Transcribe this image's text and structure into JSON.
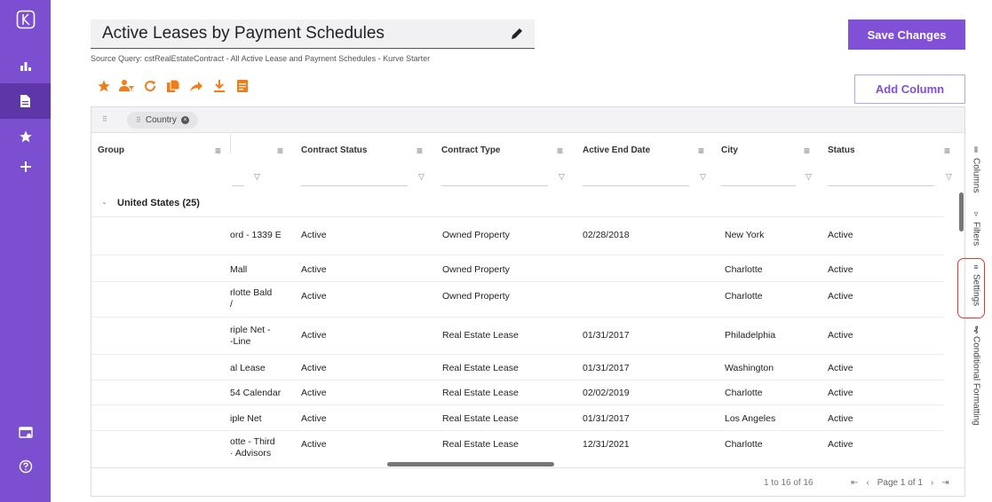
{
  "app": {
    "title": "Active Leases by Payment Schedules"
  },
  "nav": {
    "items": [
      {
        "id": "logo",
        "icon": "logo-icon"
      },
      {
        "id": "analytics",
        "icon": "bar-chart-icon"
      },
      {
        "id": "documents",
        "icon": "document-icon",
        "active": true
      },
      {
        "id": "favorites",
        "icon": "star-icon"
      },
      {
        "id": "add",
        "icon": "plus-icon"
      },
      {
        "id": "admin",
        "icon": "card-gear-icon"
      },
      {
        "id": "help",
        "icon": "help-icon"
      }
    ]
  },
  "header": {
    "source_query": "Source Query: cstRealEstateContract - All Active Lease and Payment Schedules - Kurve Starter",
    "save_label": "Save Changes",
    "add_column_label": "Add Column"
  },
  "toolbar": {
    "icons": [
      "star-icon",
      "person-filter-icon",
      "refresh-icon",
      "copy-icon",
      "share-icon",
      "download-icon",
      "notes-icon"
    ],
    "accent": "#f07d1a"
  },
  "grid": {
    "group_chip": "Country",
    "columns": {
      "group": "Group",
      "contract_status": "Contract Status",
      "contract_type": "Contract Type",
      "active_end_date": "Active End Date",
      "city": "City",
      "status": "Status"
    },
    "group_label": "United States (25)",
    "rows": [
      {
        "name": "ord - 1339 E",
        "contract_status": "Active",
        "contract_type": "Owned Property",
        "end_date": "02/28/2018",
        "city": "New York",
        "status": "Active"
      },
      {
        "name": "Mall",
        "contract_status": "Active",
        "contract_type": "Owned Property",
        "end_date": "",
        "city": "Charlotte",
        "status": "Active"
      },
      {
        "name": "rlotte Bald\n/",
        "contract_status": "Active",
        "contract_type": "Owned Property",
        "end_date": "",
        "city": "Charlotte",
        "status": "Active"
      },
      {
        "name": "riple Net -\n-Line",
        "contract_status": "Active",
        "contract_type": "Real Estate Lease",
        "end_date": "01/31/2017",
        "city": "Philadelphia",
        "status": "Active"
      },
      {
        "name": "al Lease",
        "contract_status": "Active",
        "contract_type": "Real Estate Lease",
        "end_date": "01/31/2017",
        "city": "Washington",
        "status": "Active"
      },
      {
        "name": "54 Calendar",
        "contract_status": "Active",
        "contract_type": "Real Estate Lease",
        "end_date": "02/02/2019",
        "city": "Charlotte",
        "status": "Active"
      },
      {
        "name": "iple Net",
        "contract_status": "Active",
        "contract_type": "Real Estate Lease",
        "end_date": "01/31/2017",
        "city": "Los Angeles",
        "status": "Active"
      },
      {
        "name": "otte - Third\n· Advisors",
        "contract_status": "Active",
        "contract_type": "Real Estate Lease",
        "end_date": "12/31/2021",
        "city": "Charlotte",
        "status": "Active"
      }
    ],
    "footer": {
      "count": "1 to 16 of 16",
      "page": "Page 1 of 1"
    }
  },
  "side_panel": {
    "tabs": [
      "Columns",
      "Filters",
      "Settings",
      "Conditional Formatting"
    ]
  },
  "colors": {
    "nav_bg": "#7b4fcf",
    "primary": "#8050d6",
    "highlight": "#e03b2f"
  }
}
